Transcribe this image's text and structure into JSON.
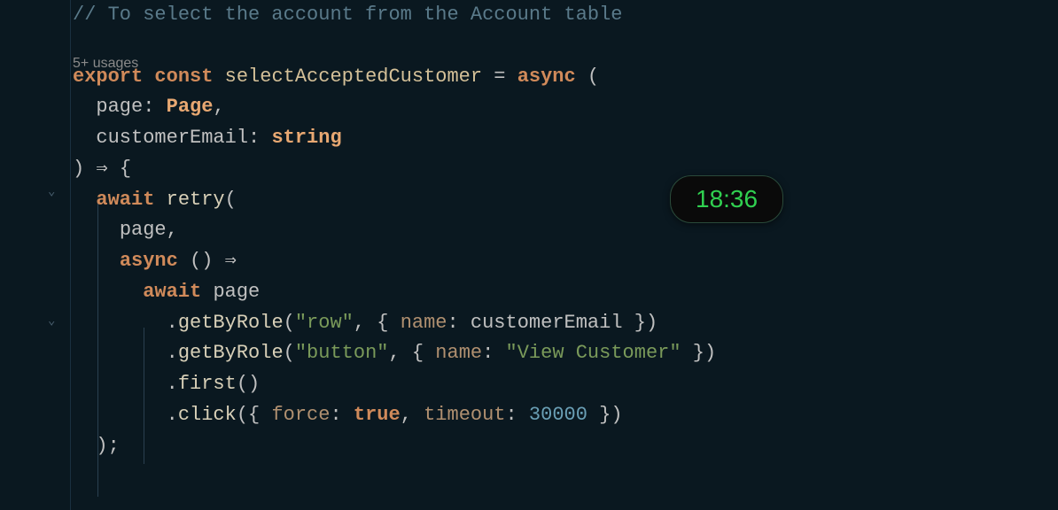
{
  "code": {
    "comment": "// To select the account from the Account table",
    "usages_hint": "5+ usages",
    "kw_export": "export",
    "kw_const": "const",
    "fn_name": "selectAcceptedCustomer",
    "eq": " = ",
    "kw_async": "async",
    "open_paren": " (",
    "param1_name": "page",
    "param1_type": "Page",
    "param2_name": "customerEmail",
    "param2_type": "string",
    "close_paren": ")",
    "arrow": " ⇒ ",
    "open_brace": "{",
    "kw_await": "await",
    "fn_retry": "retry",
    "lparen": "(",
    "arg_page": "page",
    "comma": ",",
    "inner_async": "async",
    "empty_parens": " ()",
    "arrow2": " ⇒",
    "kw_await2": "await",
    "var_page": "page",
    "method_getByRole": "getByRole",
    "str_row": "\"row\"",
    "str_button": "\"button\"",
    "prop_name": "name",
    "colon": ": ",
    "var_customerEmail": "customerEmail",
    "str_viewCustomer": "\"View Customer\"",
    "method_first": "first",
    "method_click": "click",
    "prop_force": "force",
    "val_true": "true",
    "prop_timeout": "timeout",
    "val_30000": "30000",
    "close_paren_semi": ");",
    "dot": "."
  },
  "clock": {
    "time": "18:36"
  }
}
